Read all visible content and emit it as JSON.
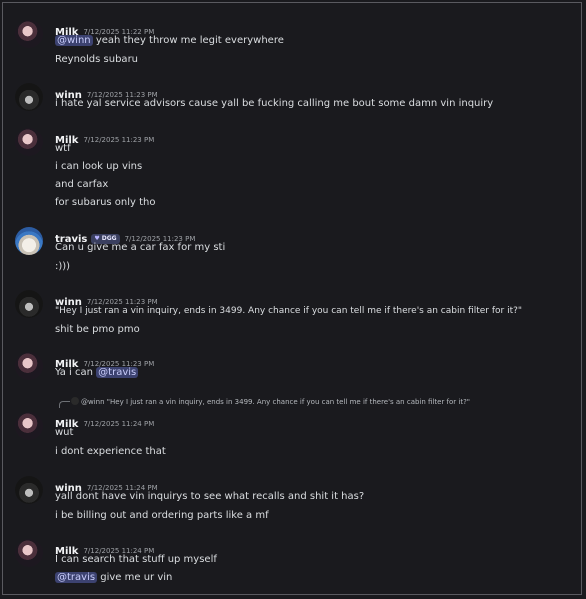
{
  "messages": [
    {
      "user": "Milk",
      "time": "7/12/2025 11:22 PM",
      "lines": [
        "yeah they throw me legit everywhere",
        "Reynolds subaru"
      ],
      "mention": "@winn"
    },
    {
      "user": "winn",
      "time": "7/12/2025 11:23 PM",
      "lines": [
        "i hate yal service advisors cause yall be fucking calling me bout some damn vin inquiry"
      ]
    },
    {
      "user": "Milk",
      "time": "7/12/2025 11:23 PM",
      "lines": [
        "wtf",
        "i can look up vins",
        "and carfax",
        "for subarus only tho"
      ]
    },
    {
      "user": "travis",
      "badge": "DGG",
      "time": "7/12/2025 11:23 PM",
      "lines": [
        "Can u give me a car fax for my sti",
        ":)))"
      ]
    },
    {
      "user": "winn",
      "time": "7/12/2025 11:23 PM",
      "lines": [
        "\"Hey I just ran a vin inquiry, ends in 3499. Any chance if you can tell me if there's an cabin filter for it?\"",
        "shit be pmo pmo"
      ]
    },
    {
      "user": "Milk",
      "time": "7/12/2025 11:23 PM",
      "lines": [
        "Ya i can"
      ],
      "mention": "@travis"
    },
    {
      "user": "Milk",
      "time": "7/12/2025 11:24 PM",
      "lines": [
        "wut",
        "i dont experience that"
      ],
      "reply": {
        "mention": "@winn",
        "text": "\"Hey I just ran a vin inquiry, ends in 3499. Any chance if you can tell me if there's an cabin filter for it?\""
      }
    },
    {
      "user": "winn",
      "time": "7/12/2025 11:24 PM",
      "lines": [
        "yall dont have vin inquirys to see what recalls and shit it has?",
        "i be billing out and ordering parts like a mf"
      ]
    },
    {
      "user": "Milk",
      "time": "7/12/2025 11:24 PM",
      "lines": [
        "I can search that stuff up myself",
        "give me ur vin"
      ],
      "mention": "@travis"
    }
  ]
}
